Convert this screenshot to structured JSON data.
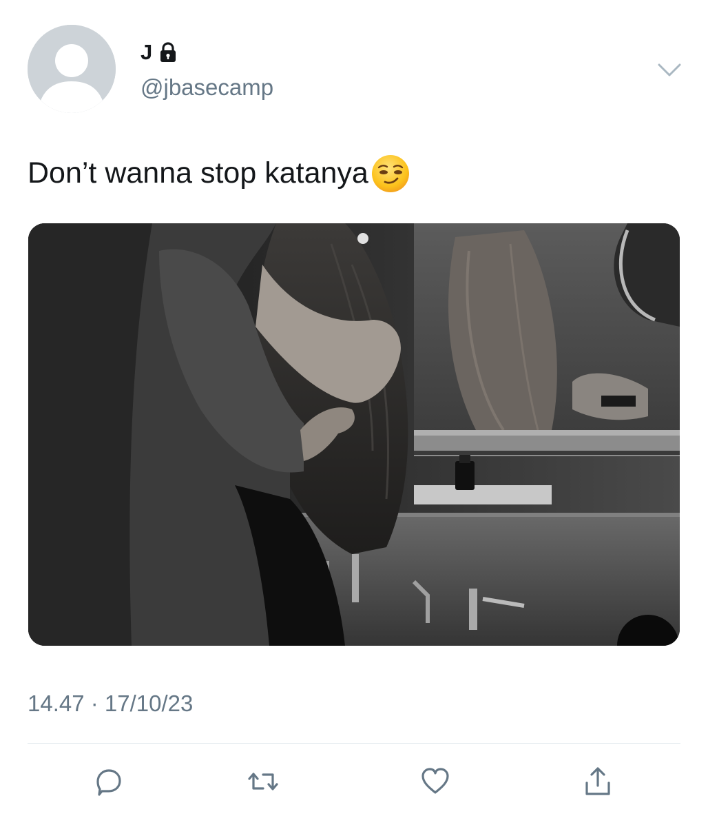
{
  "user": {
    "display_name": "J",
    "handle": "@jbasecamp",
    "protected_icon": "lock-icon",
    "avatar_icon": "default-avatar"
  },
  "tweet": {
    "text": "Don’t wanna stop katanya",
    "emoji": "smirking-face",
    "timestamp": "14.47 · 17/10/23"
  },
  "actions": [
    "reply-icon",
    "retweet-icon",
    "like-icon",
    "share-icon"
  ],
  "colors": {
    "text": "#14171a",
    "secondary": "#657786",
    "divider": "#e1e8ed",
    "avatar_bg": "#cdd3d8"
  }
}
